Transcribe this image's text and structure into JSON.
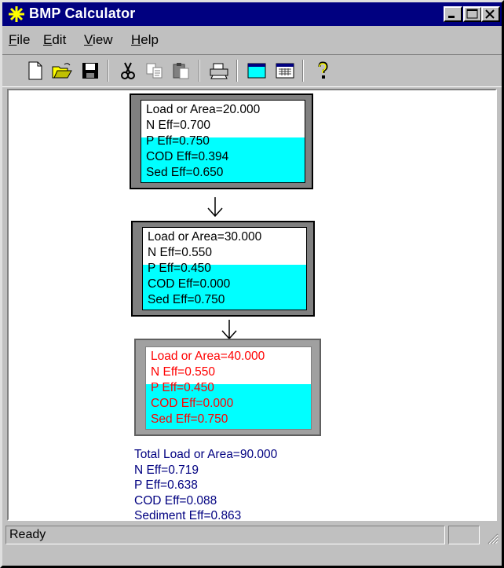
{
  "window": {
    "title": "BMP Calculator"
  },
  "menu": [
    {
      "label": "File",
      "mnemonic": "F",
      "rest": "ile"
    },
    {
      "label": "Edit",
      "mnemonic": "E",
      "rest": "dit"
    },
    {
      "label": "View",
      "mnemonic": "V",
      "rest": "iew"
    },
    {
      "label": "Help",
      "mnemonic": "H",
      "rest": "elp"
    }
  ],
  "toolbar": [
    "new-icon",
    "open-icon",
    "save-icon",
    "cut-icon",
    "copy-icon",
    "paste-icon",
    "print-icon",
    "window-icon",
    "grid-icon",
    "help-icon"
  ],
  "bmps": [
    {
      "load": "Load or Area=20.000",
      "n": "N Eff=0.700",
      "p": "P Eff=0.750",
      "cod": "COD Eff=0.394",
      "sed": "Sed Eff=0.650",
      "text_color": "#000000"
    },
    {
      "load": "Load or Area=30.000",
      "n": "N Eff=0.550",
      "p": "P Eff=0.450",
      "cod": "COD Eff=0.000",
      "sed": "Sed Eff=0.750",
      "text_color": "#000000"
    },
    {
      "load": "Load or Area=40.000",
      "n": "N Eff=0.550",
      "p": "P Eff=0.450",
      "cod": "COD Eff=0.000",
      "sed": "Sed Eff=0.750",
      "text_color": "#ff0000"
    }
  ],
  "summary": {
    "total": "Total Load or Area=90.000",
    "n": "N Eff=0.719",
    "p": "P Eff=0.638",
    "cod": "COD Eff=0.088",
    "sediment": "Sediment Eff=0.863"
  },
  "status": {
    "text": "Ready"
  },
  "colors": {
    "title_bar": "#000080",
    "fill": "#00ffff",
    "summary_text": "#000080",
    "selected_text": "#ff0000"
  }
}
